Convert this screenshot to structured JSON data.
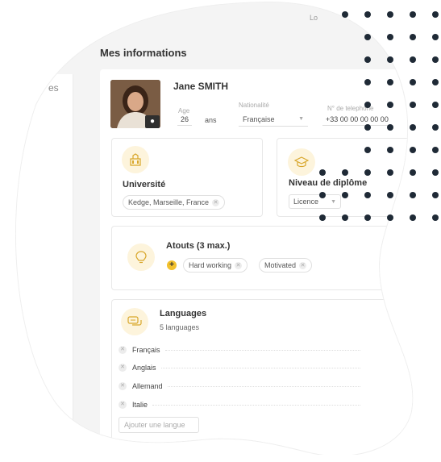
{
  "topbar": {
    "lang_fragment": "Lo"
  },
  "sidebar": {
    "fragment": "es"
  },
  "page_title": "Mes informations",
  "profile": {
    "name": "Jane SMITH",
    "age_label": "Age",
    "age_value": "26",
    "age_unit": "ans",
    "nationality_label": "Nationalité",
    "nationality_value": "Française",
    "phone_label": "N° de telephone",
    "phone_value": "+33 00 00 00 00 00"
  },
  "university": {
    "title": "Université",
    "chip": "Kedge, Marseille, France"
  },
  "degree": {
    "title": "Niveau de diplôme",
    "value": "Licence"
  },
  "assets": {
    "title": "Atouts (3 max.)",
    "chips": [
      "Hard working",
      "Motivated"
    ]
  },
  "languages": {
    "title": "Languages",
    "count": "5 languages",
    "items": [
      "Français",
      "Anglais",
      "Allemand",
      "Italie"
    ],
    "add_placeholder": "Ajouter une langue"
  },
  "icons": {
    "camera": "camera-icon",
    "university": "university-building-icon",
    "degree": "graduation-cap-icon",
    "assets": "lightbulb-icon",
    "languages": "speech-bubbles-icon",
    "add": "plus-icon",
    "remove": "remove-icon"
  },
  "colors": {
    "accent": "#f2c12e",
    "icon_bg": "#fdf4dc",
    "dots": "#1f2a36",
    "panel": "#f4f4f4"
  }
}
